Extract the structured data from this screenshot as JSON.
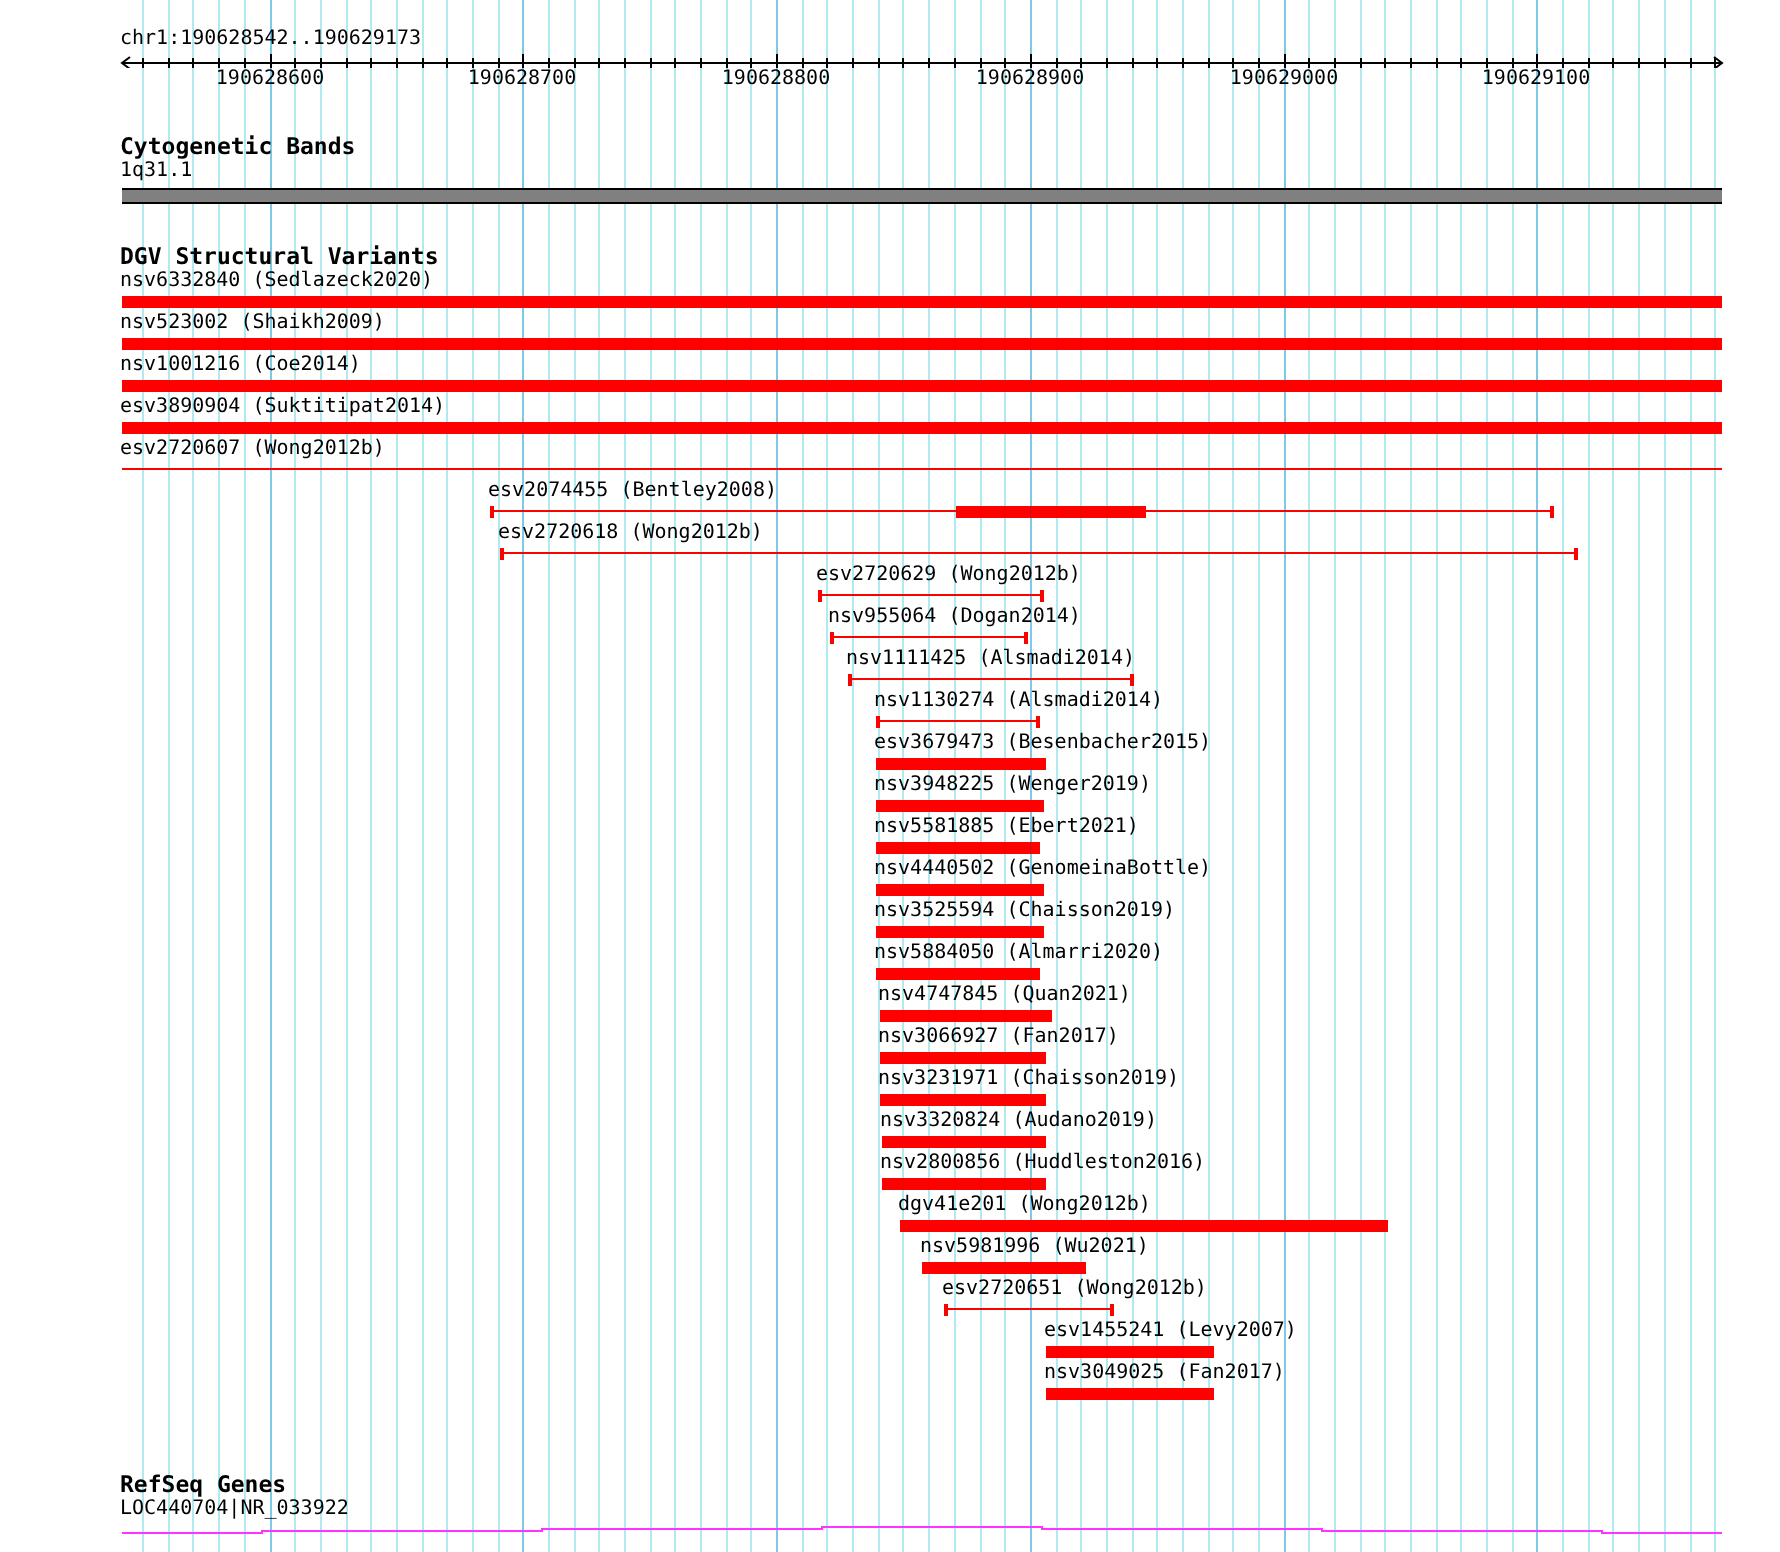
{
  "ruler": {
    "range": "chr1:190628542..190629173",
    "ticks": [
      "190628600",
      "190628700",
      "190628800",
      "190628900",
      "190629000",
      "190629100"
    ]
  },
  "tracks": [
    {
      "title": "Cytogenetic Bands",
      "features": [
        {
          "label": "1q31.1",
          "kind": "band"
        }
      ]
    },
    {
      "title": "DGV Structural Variants",
      "features": [
        {
          "label": "nsv6332840 (Sedlazeck2020)",
          "kind": "bar"
        },
        {
          "label": "nsv523002 (Shaikh2009)",
          "kind": "bar"
        },
        {
          "label": "nsv1001216 (Coe2014)",
          "kind": "bar"
        },
        {
          "label": "esv3890904 (Suktitipat2014)",
          "kind": "bar"
        },
        {
          "label": "esv2720607 (Wong2012b)",
          "kind": "line"
        },
        {
          "label": "esv2074455 (Bentley2008)",
          "kind": "core"
        },
        {
          "label": "esv2720618 (Wong2012b)",
          "kind": "span"
        },
        {
          "label": "esv2720629 (Wong2012b)",
          "kind": "span"
        },
        {
          "label": "nsv955064 (Dogan2014)",
          "kind": "span"
        },
        {
          "label": "nsv1111425 (Alsmadi2014)",
          "kind": "span"
        },
        {
          "label": "nsv1130274 (Alsmadi2014)",
          "kind": "span"
        },
        {
          "label": "esv3679473 (Besenbacher2015)",
          "kind": "bar"
        },
        {
          "label": "nsv3948225 (Wenger2019)",
          "kind": "bar"
        },
        {
          "label": "nsv5581885 (Ebert2021)",
          "kind": "bar"
        },
        {
          "label": "nsv4440502 (GenomeinaBottle)",
          "kind": "bar"
        },
        {
          "label": "nsv3525594 (Chaisson2019)",
          "kind": "bar"
        },
        {
          "label": "nsv5884050 (Almarri2020)",
          "kind": "bar"
        },
        {
          "label": "nsv4747845 (Quan2021)",
          "kind": "bar"
        },
        {
          "label": "nsv3066927 (Fan2017)",
          "kind": "bar"
        },
        {
          "label": "nsv3231971 (Chaisson2019)",
          "kind": "bar"
        },
        {
          "label": "nsv3320824 (Audano2019)",
          "kind": "bar"
        },
        {
          "label": "nsv2800856 (Huddleston2016)",
          "kind": "bar"
        },
        {
          "label": "dgv41e201 (Wong2012b)",
          "kind": "bar"
        },
        {
          "label": "nsv5981996 (Wu2021)",
          "kind": "bar"
        },
        {
          "label": "esv2720651 (Wong2012b)",
          "kind": "span"
        },
        {
          "label": "esv1455241 (Levy2007)",
          "kind": "bar"
        },
        {
          "label": "nsv3049025 (Fan2017)",
          "kind": "bar"
        }
      ]
    },
    {
      "title": "RefSeq Genes",
      "features": [
        {
          "label": "LOC440704|NR_033922",
          "kind": "gene"
        }
      ]
    }
  ]
}
